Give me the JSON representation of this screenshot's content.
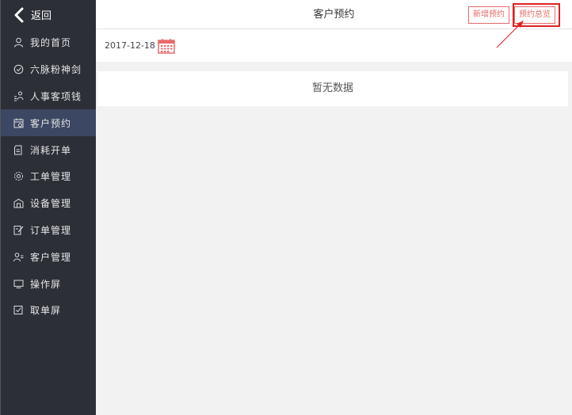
{
  "sidebar": {
    "back_label": "返回",
    "items": [
      {
        "label": "我的首页",
        "icon": "user-icon"
      },
      {
        "label": "六脉粉神剑",
        "icon": "clock-check-icon"
      },
      {
        "label": "人事客项钱",
        "icon": "person-coins-icon"
      },
      {
        "label": "客户预约",
        "icon": "calendar-icon",
        "active": true
      },
      {
        "label": "消耗开单",
        "icon": "document-icon"
      },
      {
        "label": "工单管理",
        "icon": "gear-icon"
      },
      {
        "label": "设备管理",
        "icon": "building-icon"
      },
      {
        "label": "订单管理",
        "icon": "edit-document-icon"
      },
      {
        "label": "客户管理",
        "icon": "users-icon"
      },
      {
        "label": "操作屏",
        "icon": "monitor-icon"
      },
      {
        "label": "取单屏",
        "icon": "checkbox-icon"
      }
    ]
  },
  "header": {
    "title": "客户预约",
    "new_button": "新增预约",
    "overview_button": "预约总览"
  },
  "date": {
    "value": "2017-12-18"
  },
  "content": {
    "empty_text": "暂无数据"
  },
  "colors": {
    "sidebar_bg": "#2c2f36",
    "active_bg": "#3b4763",
    "accent": "#e86a6a",
    "highlight": "#e02020"
  }
}
